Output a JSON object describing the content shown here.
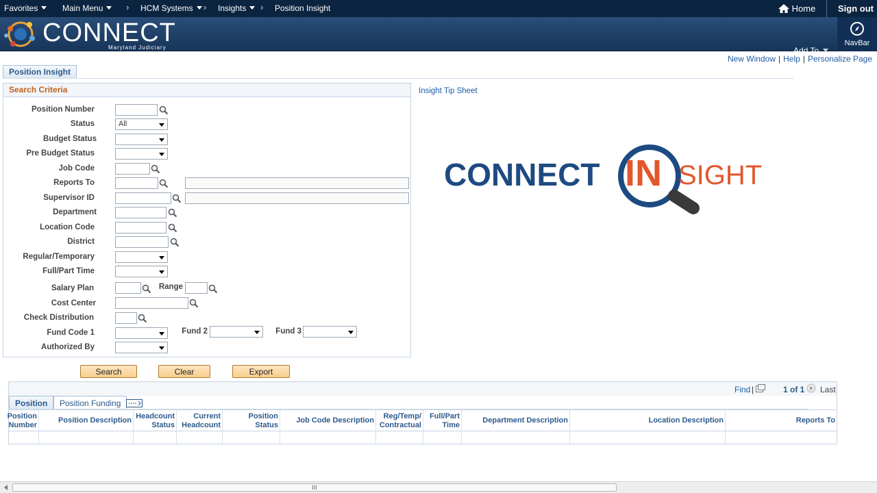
{
  "topbar": {
    "favorites": "Favorites",
    "main_menu": "Main Menu",
    "hcm_systems": "HCM Systems",
    "insights": "Insights",
    "current": "Position Insight",
    "home": "Home",
    "sign_out": "Sign out"
  },
  "brand": {
    "logo": "CONNECT",
    "subtitle": "Maryland Judiciary",
    "add_to": "Add To",
    "navbar": "NavBar"
  },
  "links": {
    "new_window": "New Window",
    "help": "Help",
    "personalize": "Personalize Page",
    "sep": "|"
  },
  "page_tab": "Position Insight",
  "search": {
    "title": "Search Criteria",
    "position_number": "Position Number",
    "status": "Status",
    "status_value": "All",
    "budget_status": "Budget Status",
    "pre_budget_status": "Pre Budget Status",
    "job_code": "Job Code",
    "reports_to": "Reports To",
    "supervisor_id": "Supervisor ID",
    "department": "Department",
    "location_code": "Location Code",
    "district": "District",
    "regular_temporary": "Regular/Temporary",
    "full_part_time": "Full/Part Time",
    "salary_plan": "Salary Plan",
    "range": "Range",
    "cost_center": "Cost Center",
    "check_distribution": "Check Distribution",
    "fund_code_1": "Fund Code 1",
    "fund_2": "Fund 2",
    "fund_3": "Fund 3",
    "authorized_by": "Authorized By"
  },
  "buttons": {
    "search": "Search",
    "clear": "Clear",
    "export": "Export"
  },
  "tip_sheet": "Insight Tip Sheet",
  "insight_logo": {
    "connect": "CONNECT",
    "in": "IN",
    "sight": "SIGHT"
  },
  "grid": {
    "find": "Find",
    "pipe": "|",
    "pager": "1 of 1",
    "last": "Last",
    "tabs": [
      "Position",
      "Position Funding"
    ],
    "columns": [
      "Position Number",
      "Position Description",
      "Headcount Status",
      "Current Headcount",
      "Position Status",
      "Job Code Description",
      "Reg/Temp/ Contractual",
      "Full/Part Time",
      "Department Description",
      "Location Description",
      "Reports To"
    ]
  },
  "scrollbar": {
    "grip": "III"
  }
}
